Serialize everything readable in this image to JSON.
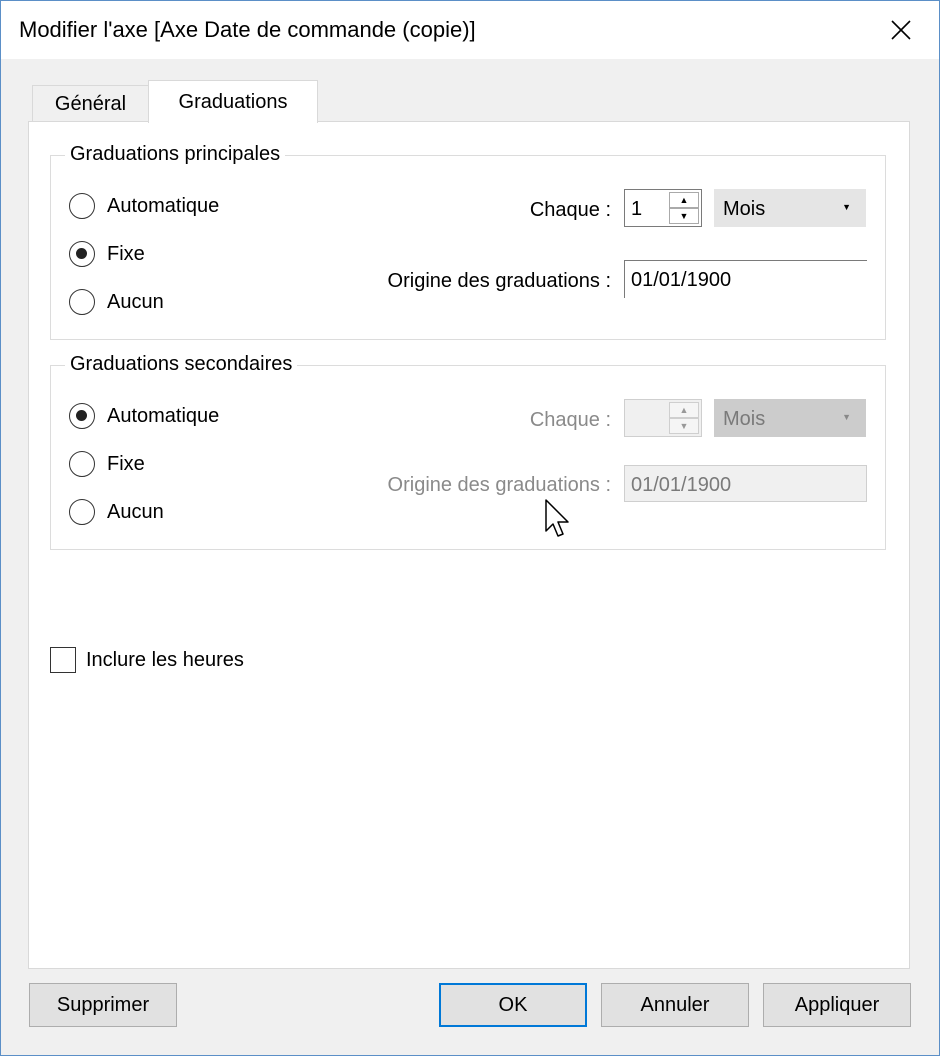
{
  "window": {
    "title": "Modifier l'axe [Axe Date de commande (copie)]",
    "close_icon": "close-icon"
  },
  "tabs": [
    {
      "label": "Général",
      "active": false
    },
    {
      "label": "Graduations",
      "active": true
    }
  ],
  "major": {
    "legend": "Graduations principales",
    "radios": [
      {
        "label": "Automatique",
        "checked": false
      },
      {
        "label": "Fixe",
        "checked": true
      },
      {
        "label": "Aucun",
        "checked": false
      }
    ],
    "every_label": "Chaque :",
    "every_value": "1",
    "unit_value": "Mois",
    "origin_label": "Origine des graduations :",
    "origin_value": "01/01/1900"
  },
  "minor": {
    "legend": "Graduations secondaires",
    "radios": [
      {
        "label": "Automatique",
        "checked": true
      },
      {
        "label": "Fixe",
        "checked": false
      },
      {
        "label": "Aucun",
        "checked": false
      }
    ],
    "every_label": "Chaque :",
    "every_value": "",
    "unit_value": "Mois",
    "origin_label": "Origine des graduations :",
    "origin_value": "01/01/1900"
  },
  "include_hours": {
    "label": "Inclure les heures",
    "checked": false
  },
  "buttons": {
    "delete": "Supprimer",
    "ok": "OK",
    "cancel": "Annuler",
    "apply": "Appliquer"
  },
  "colors": {
    "window_border": "#5b8fc7",
    "default_button_border": "#0078d7",
    "disabled_text": "#8a8a8a"
  }
}
